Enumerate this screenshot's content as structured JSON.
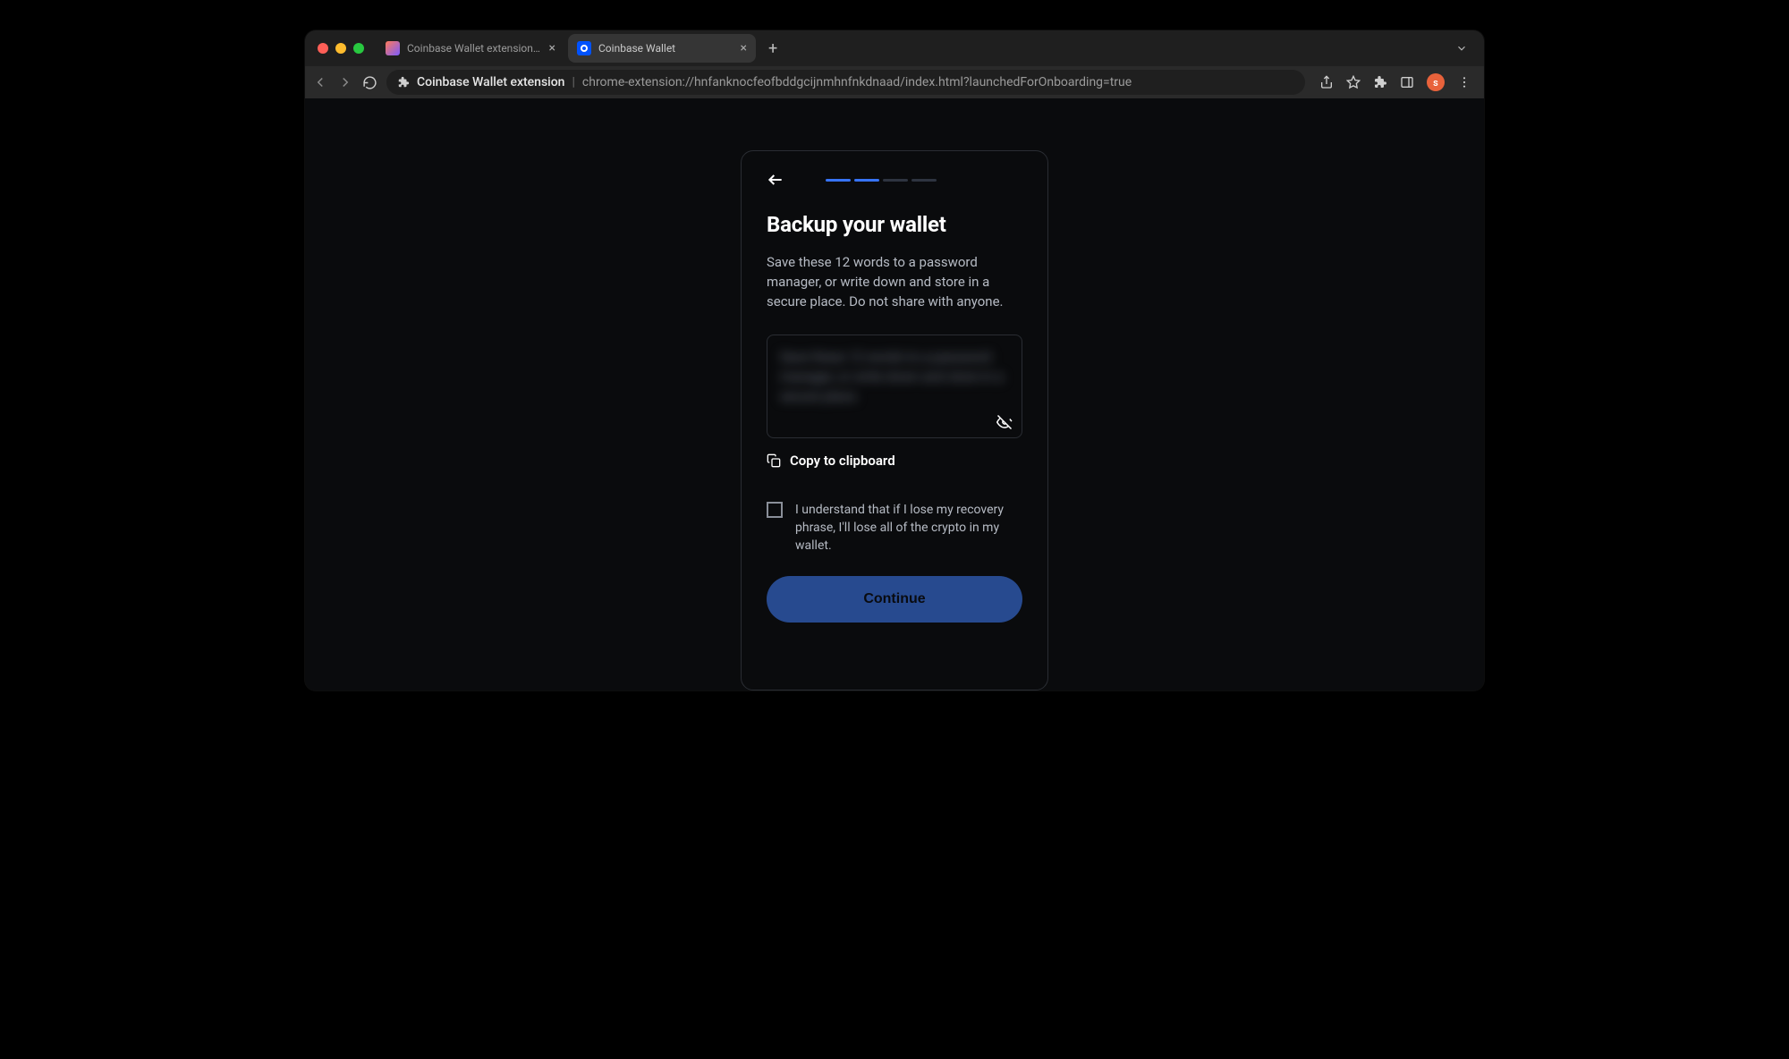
{
  "tabs": [
    {
      "title": "Coinbase Wallet extension - Ch",
      "active": false
    },
    {
      "title": "Coinbase Wallet",
      "active": true
    }
  ],
  "address_bar": {
    "label": "Coinbase Wallet extension",
    "url": "chrome-extension://hnfanknocfeofbddgcijnmhnfnkdnaad/index.html?launchedForOnboarding=true"
  },
  "avatar_initial": "s",
  "progress": {
    "current": 2,
    "total": 4
  },
  "card": {
    "title": "Backup your wallet",
    "description": "Save these 12 words to a password manager, or write down and store in a secure place. Do not share with anyone.",
    "seed_placeholder": "Save these 12 words to a password manager, or write down and store in a secure place.",
    "copy_label": "Copy to clipboard",
    "ack_text": "I understand that if I lose my recovery phrase, I'll lose all of the crypto in my wallet.",
    "continue_label": "Continue"
  }
}
